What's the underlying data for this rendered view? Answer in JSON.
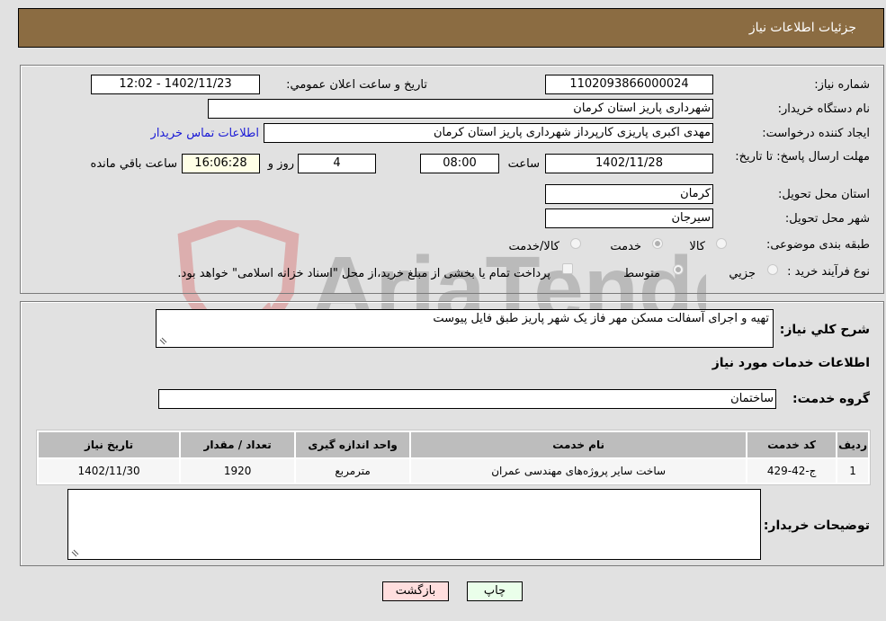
{
  "header": {
    "title": "جزئیات اطلاعات نیاز"
  },
  "form": {
    "need_number": {
      "label": "شماره نیاز:",
      "value": "1102093866000024"
    },
    "announce_datetime": {
      "label": "تاریخ و ساعت اعلان عمومي:",
      "value": "1402/11/23 - 12:02"
    },
    "buyer_org": {
      "label": "نام دستگاه خریدار:",
      "value": "شهرداری پاریز استان کرمان"
    },
    "requester": {
      "label": "ایجاد کننده درخواست:",
      "value": "مهدی اکبری پاریزی کارپرداز شهرداری پاریز استان کرمان",
      "contact_link": "اطلاعات تماس خریدار"
    },
    "deadline": {
      "label": "مهلت ارسال پاسخ: تا تاریخ:",
      "date": "1402/11/28",
      "time_label": "ساعت",
      "time": "08:00",
      "days": "4",
      "days_label": "روز و",
      "remaining": "16:06:28",
      "remaining_label": "ساعت باقي مانده"
    },
    "province": {
      "label": "استان محل تحویل:",
      "value": "کرمان"
    },
    "city": {
      "label": "شهر محل تحویل:",
      "value": "سیرجان"
    },
    "category": {
      "label": "طبقه بندی موضوعی:",
      "options": [
        {
          "label": "کالا",
          "checked": false
        },
        {
          "label": "خدمت",
          "checked": true
        },
        {
          "label": "کالا/خدمت",
          "checked": false
        }
      ]
    },
    "process": {
      "label": "نوع فرآیند خرید :",
      "options": [
        {
          "label": "جزيي",
          "checked": false
        },
        {
          "label": "متوسط",
          "checked": true
        }
      ],
      "treasury_note": "پرداخت تمام یا بخشی از مبلغ خرید،از محل \"اسناد خزانه اسلامی\" خواهد بود."
    }
  },
  "details": {
    "description_label": "شرح کلي نياز:",
    "description": "تهیه و اجرای آسفالت مسکن مهر فاز یک شهر پاریز طبق فایل پیوست",
    "services_title": "اطلاعات خدمات مورد نياز",
    "service_group_label": "گروه خدمت:",
    "service_group": "ساختمان",
    "table": {
      "headers": [
        "ردیف",
        "کد خدمت",
        "نام خدمت",
        "واحد اندازه گیری",
        "تعداد / مقدار",
        "تاریخ نیاز"
      ],
      "rows": [
        [
          "1",
          "ج-42-429",
          "ساخت سایر پروژه‌های مهندسی عمران",
          "مترمربع",
          "1920",
          "1402/11/30"
        ]
      ]
    },
    "buyer_notes_label": "توضیحات خریدار:",
    "buyer_notes": ""
  },
  "buttons": {
    "print": "چاپ",
    "back": "بازگشت"
  },
  "colors": {
    "header_bg": "#8b6c42",
    "print_bg": "#eaffea",
    "back_bg": "#ffdede",
    "link": "#1a1ad6"
  }
}
